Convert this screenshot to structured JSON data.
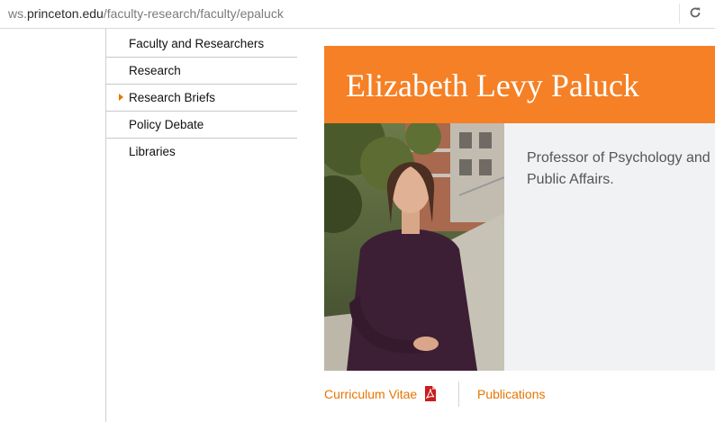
{
  "address_bar": {
    "url_prefix": "ws.",
    "url_host": "princeton.edu",
    "url_path": "/faculty-research/faculty/epaluck",
    "reload_icon": "reload-icon"
  },
  "sidebar": {
    "items": [
      {
        "label": "Faculty and Researchers"
      },
      {
        "label": "Research"
      },
      {
        "label": "Research Briefs",
        "expandable": true
      },
      {
        "label": "Policy Debate"
      },
      {
        "label": "Libraries"
      }
    ]
  },
  "profile": {
    "name": "Elizabeth Levy Paluck",
    "title": "Professor of Psychology and Public Affairs.",
    "photo_alt": "photo of faculty member"
  },
  "links": {
    "cv_label": "Curriculum Vitae",
    "cv_icon": "pdf-icon",
    "publications_label": "Publications"
  },
  "colors": {
    "accent": "#f58025",
    "link": "#e77500",
    "panel_bg": "#f1f2f3"
  }
}
